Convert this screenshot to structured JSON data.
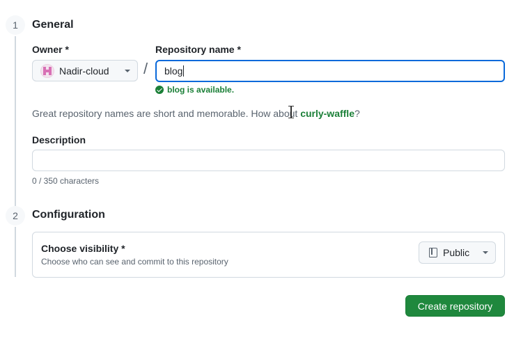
{
  "sections": [
    {
      "number": "1",
      "title": "General"
    },
    {
      "number": "2",
      "title": "Configuration"
    }
  ],
  "owner": {
    "label": "Owner *",
    "value": "Nadir-cloud",
    "avatar_icon": "identicon-avatar",
    "avatar_color": "#d870b5"
  },
  "separator": "/",
  "repo_name": {
    "label": "Repository name *",
    "value": "blog",
    "status": "blog is available.",
    "status_icon": "check-circle-icon",
    "status_color": "#1a7f37"
  },
  "hint": {
    "prefix": "Great repository names are short and memorable. How about ",
    "suggestion": "curly-waffle",
    "suffix": "?"
  },
  "description": {
    "label": "Description",
    "value": "",
    "char_count": "0 / 350 characters"
  },
  "visibility": {
    "title": "Choose visibility *",
    "subtitle": "Choose who can see and commit to this repository",
    "selected": "Public",
    "icon": "repo-icon"
  },
  "actions": {
    "create_label": "Create repository",
    "create_color": "#1f883d"
  }
}
